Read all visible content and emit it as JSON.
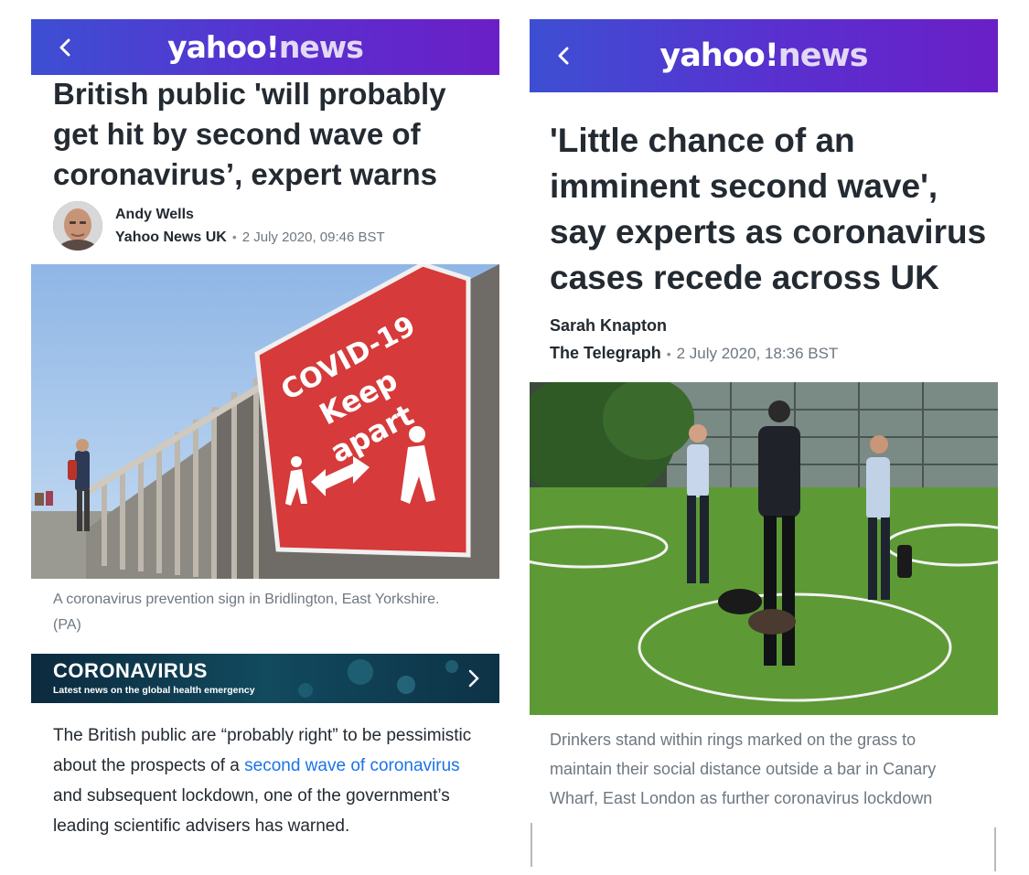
{
  "left": {
    "logo": {
      "yahoo": "yahoo!",
      "news": "news"
    },
    "headline": "British public 'will probably get hit by second wave of coronavirus’, expert warns",
    "author": "Andy Wells",
    "source": "Yahoo News UK",
    "date": "2 July 2020, 09:46 BST",
    "sign": {
      "line1": "COVID-19",
      "line2": "Keep",
      "line3": "apart"
    },
    "caption": "A coronavirus prevention sign in Bridlington, East Yorkshire. (PA)",
    "banner": {
      "title": "CORONAVIRUS",
      "subtitle": "Latest news on the global health emergency"
    },
    "body": {
      "before": "The British public are “probably right” to be pessimistic about the prospects of a ",
      "link": "second wave of coronavirus",
      "after": " and subsequent lockdown, one of the government’s leading scientific advisers has warned."
    }
  },
  "right": {
    "logo": {
      "yahoo": "yahoo!",
      "news": "news"
    },
    "headline_lines": [
      "'Little chance of an",
      "imminent second wave',",
      "say experts as coronavirus",
      "cases recede across UK"
    ],
    "author": "Sarah Knapton",
    "source": "The Telegraph",
    "date": "2 July 2020, 18:36 BST",
    "caption_lines": [
      "Drinkers stand within rings marked on the grass to",
      "maintain their social distance outside a bar in Canary",
      "Wharf, East London as further coronavirus lockdown"
    ]
  },
  "colors": {
    "header_start": "#3d4fd3",
    "header_end": "#6a1fc6",
    "link": "#1a73e8",
    "sign_red": "#d63a3a"
  },
  "icons": [
    "back-chevron-icon",
    "chevron-right-icon"
  ]
}
